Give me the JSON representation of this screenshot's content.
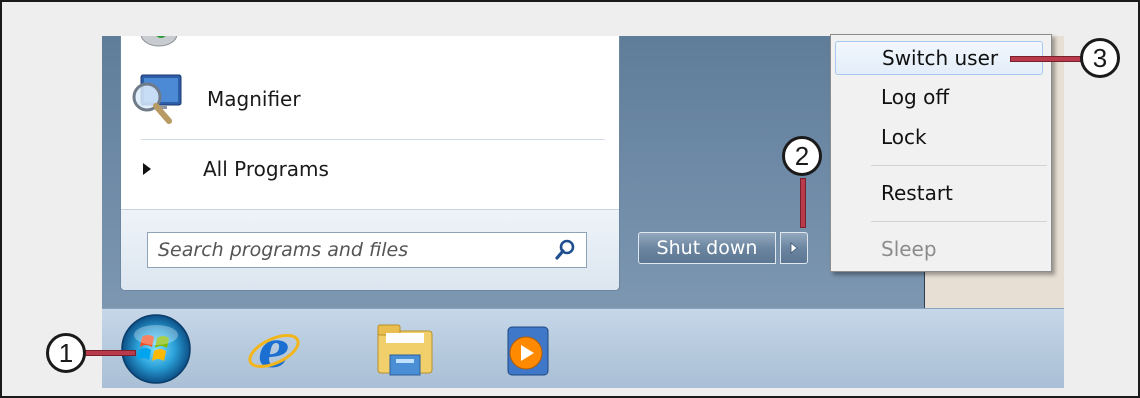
{
  "left_pane": {
    "programs": [
      {
        "label": "Magnifier",
        "icon": "magnifier-icon"
      }
    ],
    "all_programs": {
      "label": "All Programs",
      "icon": "triangle-right-icon"
    },
    "search": {
      "placeholder": "Search programs and files",
      "icon": "search-icon"
    }
  },
  "power": {
    "shutdown_label": "Shut down",
    "arrow_icon": "chevron-right-icon"
  },
  "context_menu": {
    "items": [
      {
        "label": "Switch user",
        "state": "hover"
      },
      {
        "label": "Log off",
        "state": "normal"
      },
      {
        "label": "Lock",
        "state": "normal"
      },
      {
        "label": "Restart",
        "state": "normal"
      },
      {
        "label": "Sleep",
        "state": "disabled"
      }
    ]
  },
  "taskbar": {
    "items": [
      {
        "icon": "windows-start-orb-icon"
      },
      {
        "icon": "internet-explorer-icon"
      },
      {
        "icon": "file-explorer-folder-icon"
      },
      {
        "icon": "media-player-icon"
      }
    ]
  },
  "callouts": [
    {
      "label": "1"
    },
    {
      "label": "2"
    },
    {
      "label": "3"
    }
  ],
  "colors": {
    "callout_connector": "#b83a4b",
    "start_menu_right": "#6e8aa6",
    "taskbar": "#b5c9dd",
    "hover_highlight": "#e3edf9"
  }
}
